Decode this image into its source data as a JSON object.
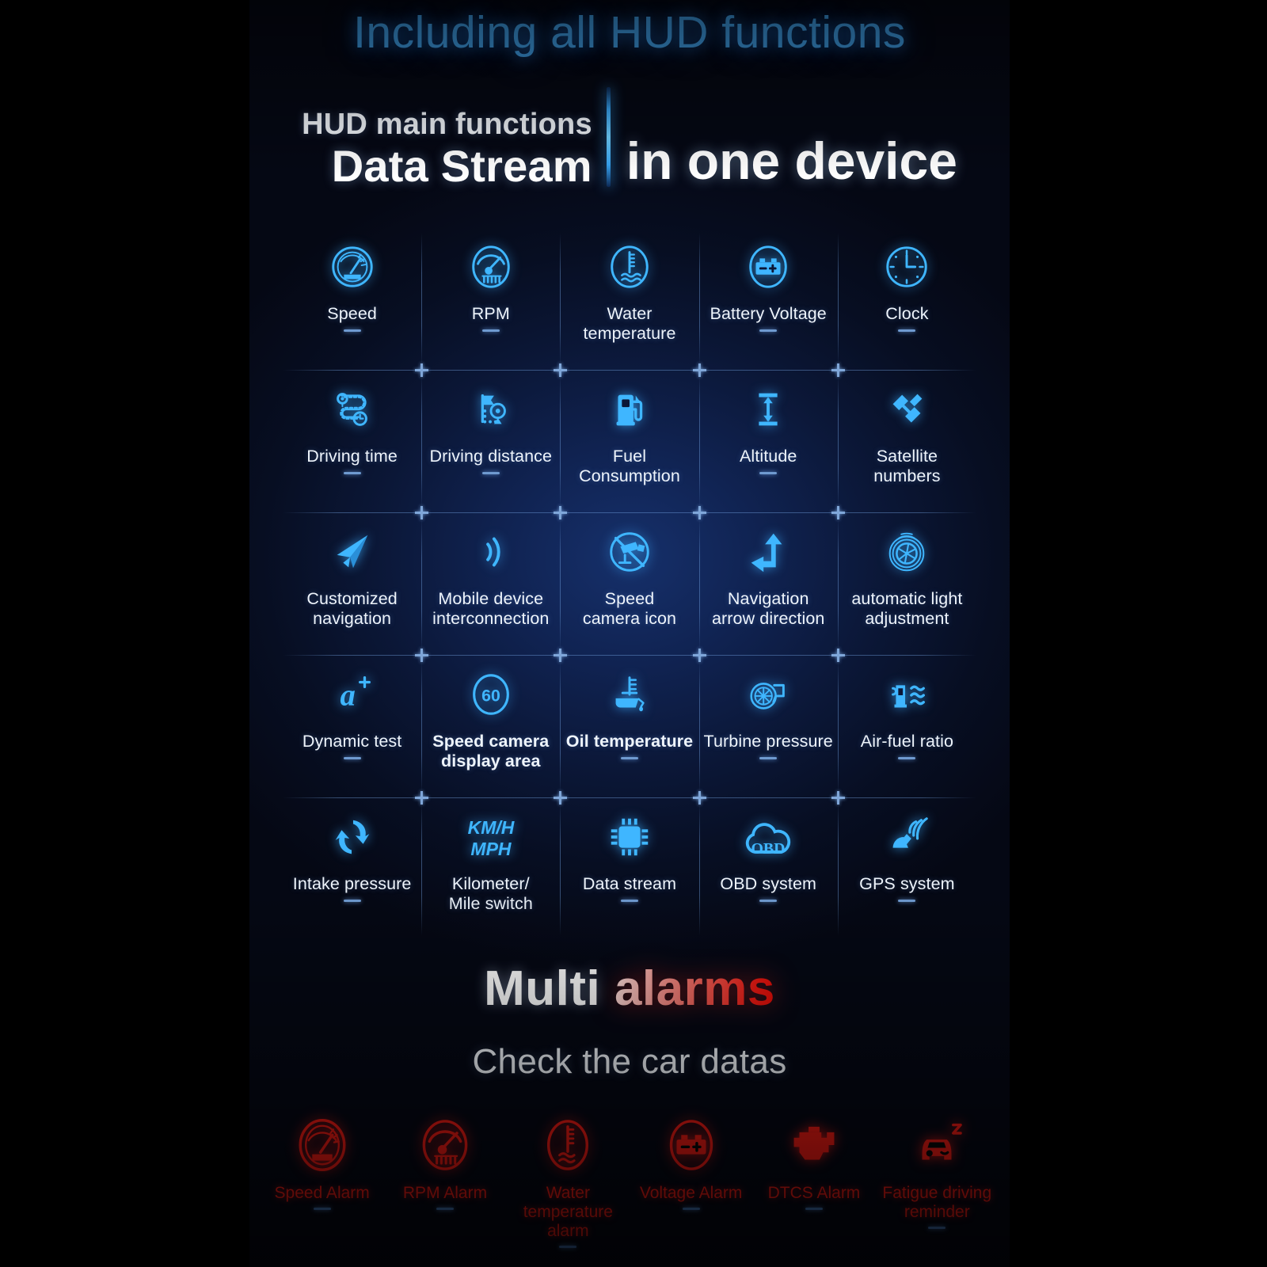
{
  "header": {
    "top_title": "Including all HUD functions",
    "left_line1": "HUD main functions",
    "left_line2": "Data Stream",
    "right_title": "in one device"
  },
  "colors": {
    "accent_blue": "#3fb6ff",
    "title_blue": "#3f9fe8",
    "alarm_red": "#ef1b14",
    "panel_bg": "#0b1737",
    "label_white": "#eef4fb",
    "dash_blue": "#6f9ad0"
  },
  "grid": {
    "rows": [
      [
        {
          "label": "Speed",
          "icon": "speedometer-icon",
          "dash": true,
          "bold": false
        },
        {
          "label": "RPM",
          "icon": "rpm-gauge-icon",
          "dash": true,
          "bold": false
        },
        {
          "label": "Water\ntemperature",
          "icon": "water-temperature-icon",
          "dash": false,
          "bold": false
        },
        {
          "label": "Battery Voltage",
          "icon": "battery-icon",
          "dash": true,
          "bold": false
        },
        {
          "label": "Clock",
          "icon": "clock-icon",
          "dash": true,
          "bold": false
        }
      ],
      [
        {
          "label": "Driving time",
          "icon": "route-timer-icon",
          "dash": true,
          "bold": false
        },
        {
          "label": "Driving distance",
          "icon": "flag-pin-route-icon",
          "dash": true,
          "bold": false
        },
        {
          "label": "Fuel\nConsumption",
          "icon": "fuel-pump-icon",
          "dash": false,
          "bold": false
        },
        {
          "label": "Altitude",
          "icon": "altitude-arrow-icon",
          "dash": true,
          "bold": false
        },
        {
          "label": "Satellite\nnumbers",
          "icon": "satellite-icon",
          "dash": false,
          "bold": false
        }
      ],
      [
        {
          "label": "Customized\nnavigation",
          "icon": "paper-plane-icon",
          "dash": false,
          "bold": false
        },
        {
          "label": "Mobile device\ninterconnection",
          "icon": "wireless-waves-icon",
          "dash": false,
          "bold": false
        },
        {
          "label": "Speed\ncamera icon",
          "icon": "speed-camera-icon",
          "dash": false,
          "bold": false
        },
        {
          "label": "Navigation\narrow direction",
          "icon": "navigation-arrow-icon",
          "dash": false,
          "bold": false
        },
        {
          "label": "automatic light\nadjustment",
          "icon": "light-sensor-aperture-icon",
          "dash": false,
          "bold": false
        }
      ],
      [
        {
          "label": "Dynamic test",
          "icon": "a-plus-icon",
          "dash": true,
          "bold": false
        },
        {
          "label": "Speed camera\ndisplay area",
          "icon": "speed-limit-60-icon",
          "dash": false,
          "bold": true
        },
        {
          "label": "Oil temperature",
          "icon": "oil-temperature-icon",
          "dash": true,
          "bold": true
        },
        {
          "label": "Turbine pressure",
          "icon": "turbo-icon",
          "dash": true,
          "bold": false
        },
        {
          "label": "Air-fuel ratio",
          "icon": "air-fuel-ratio-icon",
          "dash": true,
          "bold": false
        }
      ],
      [
        {
          "label": "Intake pressure",
          "icon": "intake-recycle-icon",
          "dash": true,
          "bold": false
        },
        {
          "label": "Kilometer/\nMile switch",
          "icon": "kmh-mph-icon",
          "dash": false,
          "bold": false
        },
        {
          "label": "Data stream",
          "icon": "chip-icon",
          "dash": true,
          "bold": false
        },
        {
          "label": "OBD system",
          "icon": "obd-cloud-icon",
          "dash": true,
          "bold": false
        },
        {
          "label": "GPS system",
          "icon": "gps-satellite-signal-icon",
          "dash": true,
          "bold": false
        }
      ]
    ],
    "kmh_mph": {
      "line1": "KM/H",
      "line2": "MPH"
    },
    "speed_limit_value": "60",
    "obd_text": "OBD",
    "speedometer_unit": "KM/H",
    "dynamic_test_glyph": "a+"
  },
  "alarms_section": {
    "title_white": "Multi ",
    "title_red": "alarms",
    "subtitle": "Check the car datas",
    "items": [
      {
        "label": "Speed Alarm",
        "icon": "speed-alarm-icon"
      },
      {
        "label": "RPM Alarm",
        "icon": "rpm-alarm-icon"
      },
      {
        "label": "Water\ntemperature\nalarm",
        "icon": "water-temperature-alarm-icon"
      },
      {
        "label": "Voltage Alarm",
        "icon": "voltage-alarm-icon"
      },
      {
        "label": "DTCS Alarm",
        "icon": "dtcs-engine-alarm-icon"
      },
      {
        "label": "Fatigue driving\nreminder",
        "icon": "fatigue-driving-icon"
      }
    ]
  }
}
